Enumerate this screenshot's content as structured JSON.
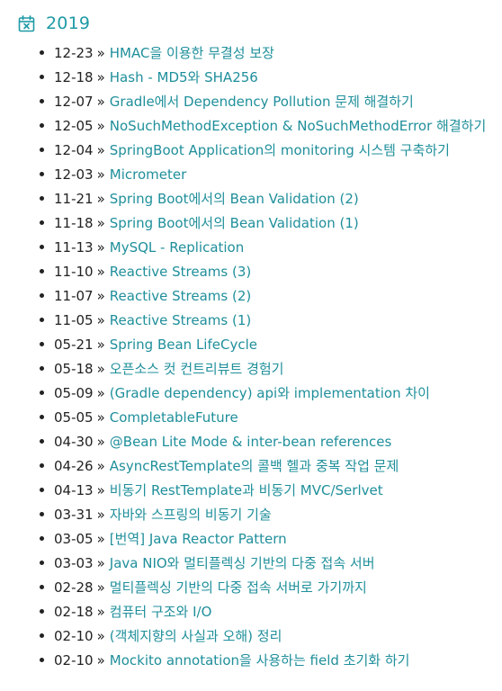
{
  "header": {
    "icon": "calendar-x-icon",
    "year": "2019",
    "accent_color": "#1f9aa6"
  },
  "separator": "»",
  "posts": [
    {
      "date": "12-23",
      "title": "HMAC을 이용한 무결성 보장"
    },
    {
      "date": "12-18",
      "title": "Hash - MD5와 SHA256"
    },
    {
      "date": "12-07",
      "title": "Gradle에서 Dependency Pollution 문제 해결하기"
    },
    {
      "date": "12-05",
      "title": "NoSuchMethodException & NoSuchMethodError 해결하기"
    },
    {
      "date": "12-04",
      "title": "SpringBoot Application의 monitoring 시스템 구축하기"
    },
    {
      "date": "12-03",
      "title": "Micrometer"
    },
    {
      "date": "11-21",
      "title": "Spring Boot에서의 Bean Validation (2)"
    },
    {
      "date": "11-18",
      "title": "Spring Boot에서의 Bean Validation (1)"
    },
    {
      "date": "11-13",
      "title": "MySQL - Replication"
    },
    {
      "date": "11-10",
      "title": "Reactive Streams (3)"
    },
    {
      "date": "11-07",
      "title": "Reactive Streams (2)"
    },
    {
      "date": "11-05",
      "title": "Reactive Streams (1)"
    },
    {
      "date": "05-21",
      "title": "Spring Bean LifeCycle"
    },
    {
      "date": "05-18",
      "title": "오픈소스 컷 컨트리뷰트 경험기"
    },
    {
      "date": "05-09",
      "title": "(Gradle dependency) api와 implementation 차이"
    },
    {
      "date": "05-05",
      "title": "CompletableFuture"
    },
    {
      "date": "04-30",
      "title": "@Bean Lite Mode & inter-bean references"
    },
    {
      "date": "04-26",
      "title": "AsyncRestTemplate의 콜백 헬과 중복 작업 문제"
    },
    {
      "date": "04-13",
      "title": "비동기 RestTemplate과 비동기 MVC/Serlvet"
    },
    {
      "date": "03-31",
      "title": "자바와 스프링의 비동기 기술"
    },
    {
      "date": "03-05",
      "title": "[번역] Java Reactor Pattern"
    },
    {
      "date": "03-03",
      "title": "Java NIO와 멀티플렉싱 기반의 다중 접속 서버"
    },
    {
      "date": "02-28",
      "title": "멀티플렉싱 기반의 다중 접속 서버로 가기까지"
    },
    {
      "date": "02-18",
      "title": "컴퓨터 구조와 I/O"
    },
    {
      "date": "02-10",
      "title": "(객체지향의 사실과 오해) 정리"
    },
    {
      "date": "02-10",
      "title": "Mockito annotation을 사용하는 field 초기화 하기"
    }
  ]
}
